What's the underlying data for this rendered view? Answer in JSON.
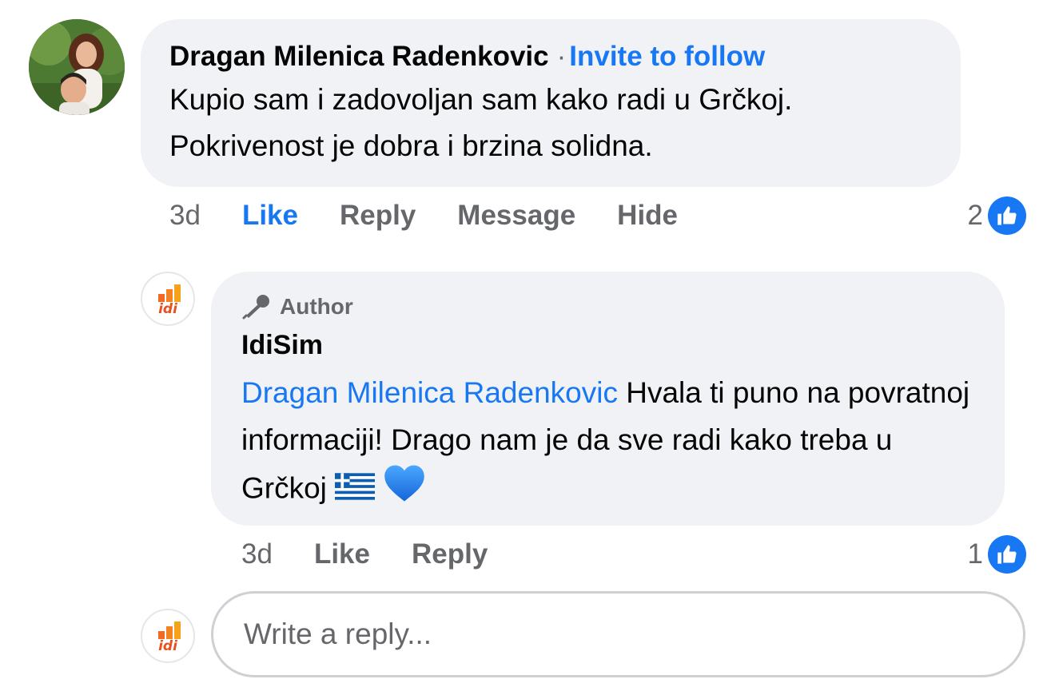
{
  "comment": {
    "author_name": "Dragan Milenica Radenkovic",
    "separator": "·",
    "invite_label": "Invite to follow",
    "text": "Kupio sam i zadovoljan sam kako radi u Grčkoj. Pokrivenost je dobra i brzina solidna.",
    "time": "3d",
    "actions": {
      "like": "Like",
      "reply": "Reply",
      "message": "Message",
      "hide": "Hide"
    },
    "reaction_count": "2",
    "reaction_icon": "thumbs-up-icon",
    "avatar_icon": "couple-photo-avatar"
  },
  "reply": {
    "badge_label": "Author",
    "badge_icon": "microphone-icon",
    "author_name": "IdiSim",
    "mention": "Dragan Milenica Radenkovic",
    "text": " Hvala ti puno na povratnoj informaciji! Drago nam je da sve radi kako treba u Grčkoj",
    "emojis": [
      "greek-flag-emoji",
      "blue-heart-emoji"
    ],
    "time": "3d",
    "actions": {
      "like": "Like",
      "reply": "Reply"
    },
    "reaction_count": "1",
    "reaction_icon": "thumbs-up-icon",
    "avatar_icon": "idi-logo-avatar"
  },
  "composer": {
    "placeholder": "Write a reply...",
    "value": "",
    "avatar_icon": "idi-logo-avatar"
  },
  "colors": {
    "accent": "#1877f2",
    "secondary_text": "#65676b",
    "bubble_bg": "#f0f2f5",
    "brand_orange": "#f26a21"
  }
}
